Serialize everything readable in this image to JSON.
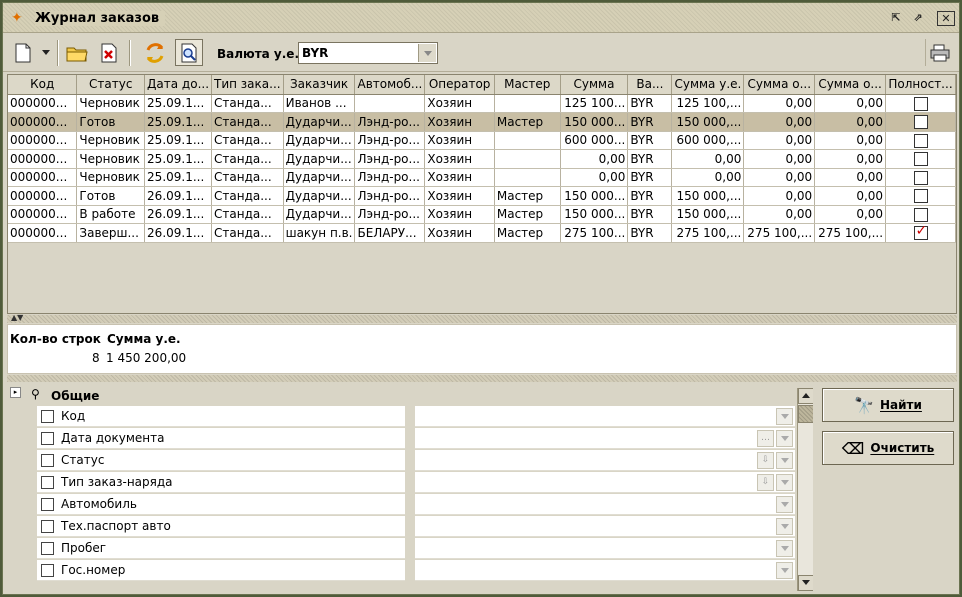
{
  "window": {
    "title": "Журнал заказов",
    "controls": [
      "restore-icon",
      "maximize-icon",
      "close-icon"
    ]
  },
  "toolbar": {
    "currency_label": "Валюта у.е.",
    "currency_value": "BYR",
    "tools": [
      "new-document-icon",
      "dropdown-arrow-icon",
      "open-folder-icon",
      "delete-icon",
      "refresh-icon",
      "search-doc-icon"
    ],
    "print_icon": "printer-icon"
  },
  "grid": {
    "columns": [
      "Код",
      "Статус",
      "Дата до...",
      "Тип зака...",
      "Заказчик",
      "Автомоб...",
      "Оператор",
      "Мастер",
      "Сумма",
      "Ва...",
      "Сумма у.е.",
      "Сумма о...",
      "Сумма о...",
      "Полност..."
    ],
    "rows": [
      {
        "code": "000000...",
        "status": "Черновик",
        "date": "25.09.1...",
        "type": "Станда...",
        "customer": "Иванов ...",
        "car": "",
        "operator": "Хозяин",
        "master": "",
        "sum": "125 100...",
        "cur": "BYR",
        "sum_ue": "125 100,...",
        "sum_o1": "0,00",
        "sum_o2": "0,00",
        "full": false,
        "selected": false
      },
      {
        "code": "000000...",
        "status": "Готов",
        "date": "25.09.1...",
        "type": "Станда...",
        "customer": "Дударчи...",
        "car": "Лэнд-ро...",
        "operator": "Хозяин",
        "master": "Мастер",
        "sum": "150 000...",
        "cur": "BYR",
        "sum_ue": "150 000,...",
        "sum_o1": "0,00",
        "sum_o2": "0,00",
        "full": false,
        "selected": true
      },
      {
        "code": "000000...",
        "status": "Черновик",
        "date": "25.09.1...",
        "type": "Станда...",
        "customer": "Дударчи...",
        "car": "Лэнд-ро...",
        "operator": "Хозяин",
        "master": "",
        "sum": "600 000...",
        "cur": "BYR",
        "sum_ue": "600 000,...",
        "sum_o1": "0,00",
        "sum_o2": "0,00",
        "full": false,
        "selected": false
      },
      {
        "code": "000000...",
        "status": "Черновик",
        "date": "25.09.1...",
        "type": "Станда...",
        "customer": "Дударчи...",
        "car": "Лэнд-ро...",
        "operator": "Хозяин",
        "master": "",
        "sum": "0,00",
        "cur": "BYR",
        "sum_ue": "0,00",
        "sum_o1": "0,00",
        "sum_o2": "0,00",
        "full": false,
        "selected": false
      },
      {
        "code": "000000...",
        "status": "Черновик",
        "date": "25.09.1...",
        "type": "Станда...",
        "customer": "Дударчи...",
        "car": "Лэнд-ро...",
        "operator": "Хозяин",
        "master": "",
        "sum": "0,00",
        "cur": "BYR",
        "sum_ue": "0,00",
        "sum_o1": "0,00",
        "sum_o2": "0,00",
        "full": false,
        "selected": false
      },
      {
        "code": "000000...",
        "status": "Готов",
        "date": "26.09.1...",
        "type": "Станда...",
        "customer": "Дударчи...",
        "car": "Лэнд-ро...",
        "operator": "Хозяин",
        "master": "Мастер",
        "sum": "150 000...",
        "cur": "BYR",
        "sum_ue": "150 000,...",
        "sum_o1": "0,00",
        "sum_o2": "0,00",
        "full": false,
        "selected": false
      },
      {
        "code": "000000...",
        "status": "В работе",
        "date": "26.09.1...",
        "type": "Станда...",
        "customer": "Дударчи...",
        "car": "Лэнд-ро...",
        "operator": "Хозяин",
        "master": "Мастер",
        "sum": "150 000...",
        "cur": "BYR",
        "sum_ue": "150 000,...",
        "sum_o1": "0,00",
        "sum_o2": "0,00",
        "full": false,
        "selected": false
      },
      {
        "code": "000000...",
        "status": "Заверш...",
        "date": "26.09.1...",
        "type": "Станда...",
        "customer": "шакун п.в.",
        "car": "БЕЛАРУ...",
        "operator": "Хозяин",
        "master": "Мастер",
        "sum": "275 100...",
        "cur": "BYR",
        "sum_ue": "275 100,...",
        "sum_o1": "275 100,...",
        "sum_o2": "275 100,...",
        "full": true,
        "selected": false
      }
    ]
  },
  "summary": {
    "count_label": "Кол-во строк",
    "sum_label": "Сумма у.е.",
    "count_value": "8",
    "sum_value": "1 450 200,00"
  },
  "filter": {
    "group_label": "Общие",
    "fields": [
      {
        "label": "Код",
        "extra": ""
      },
      {
        "label": "Дата документа",
        "extra": "…"
      },
      {
        "label": "Статус",
        "extra": "filter"
      },
      {
        "label": "Тип заказ-наряда",
        "extra": "filter"
      },
      {
        "label": "Автомобиль",
        "extra": ""
      },
      {
        "label": "Тех.паспорт авто",
        "extra": ""
      },
      {
        "label": "Пробег",
        "extra": ""
      },
      {
        "label": "Гос.номер",
        "extra": ""
      }
    ]
  },
  "actions": {
    "find_label": "Найти",
    "clear_label": "Очистить"
  }
}
